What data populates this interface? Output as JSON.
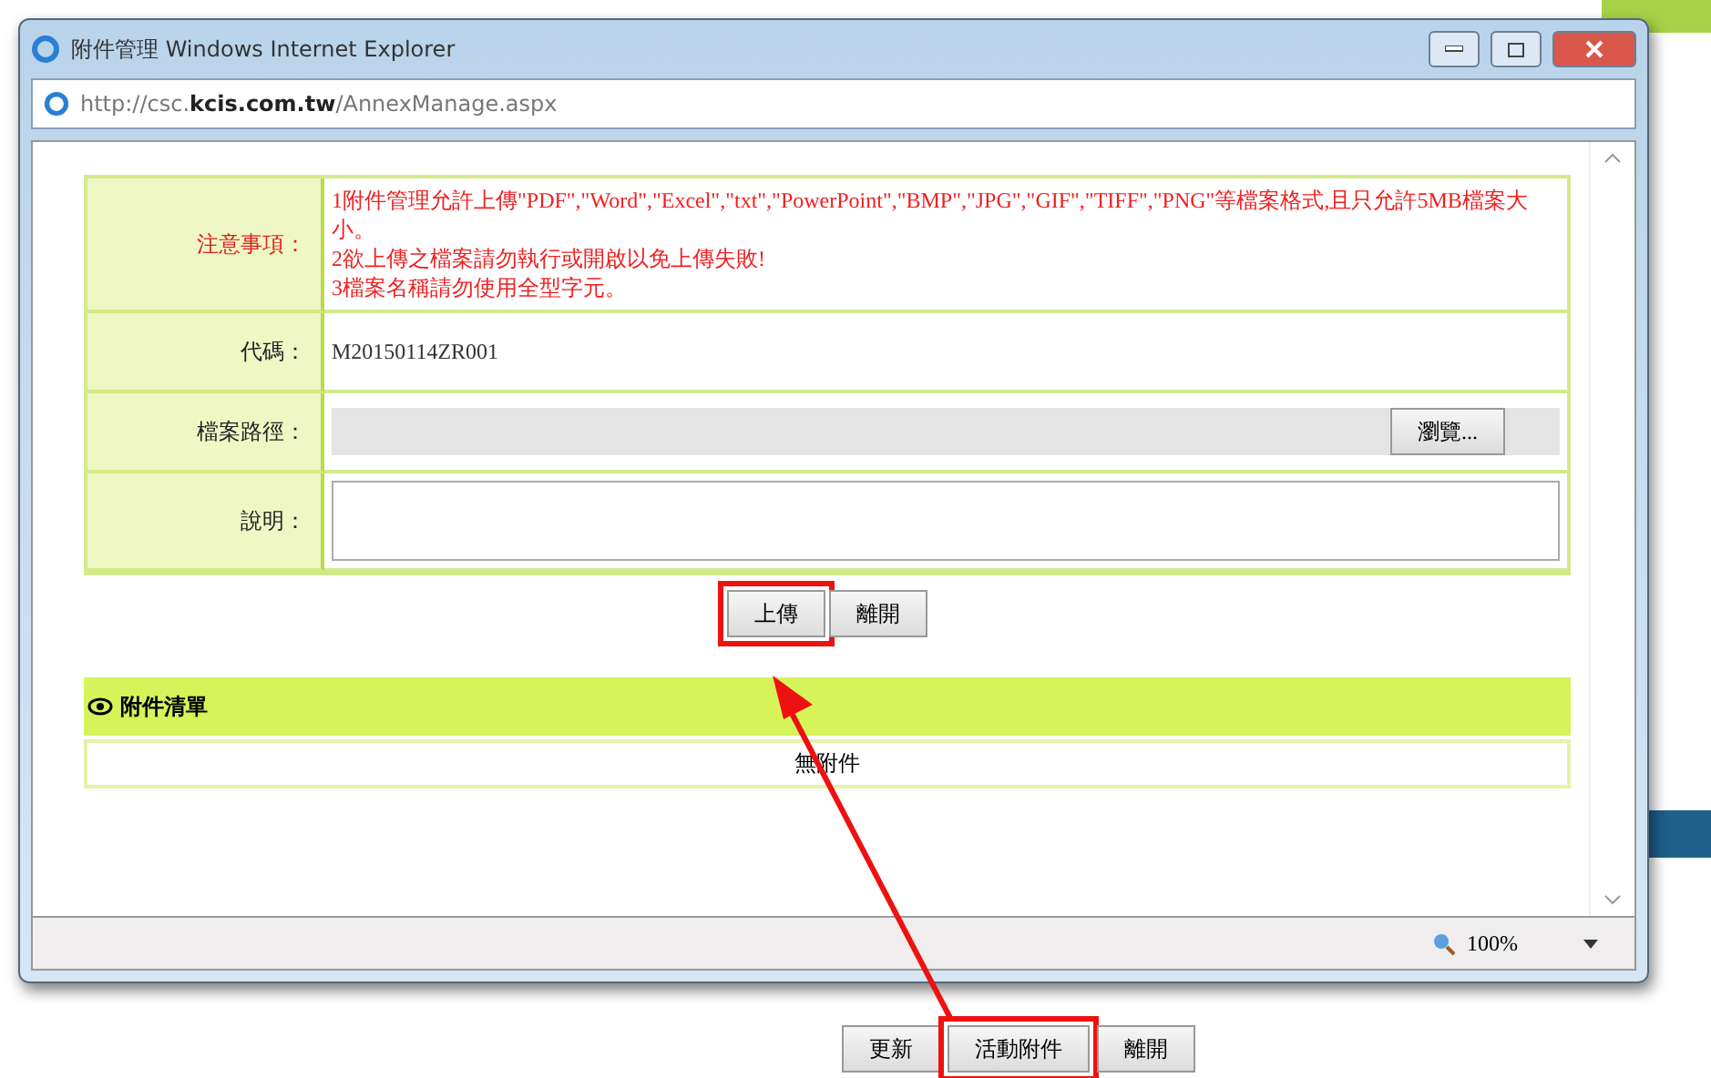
{
  "window": {
    "title": "附件管理 Windows Internet Explorer",
    "address": "http://csc.**kcis.com.tw**/AnnexManage.aspx"
  },
  "form": [
    {
      "kind": "notes",
      "label": "注意事項：",
      "lines": [
        "1附件管理允許上傳\"PDF\",\"Word\",\"Excel\",\"txt\",\"PowerPoint\",\"BMP\",\"JPG\",\"GIF\",\"TIFF\",\"PNG\"等檔案格式,且只允許5MB檔案大小。",
        "2欲上傳之檔案請勿執行或開啟以免上傳失敗!",
        "3檔案名稱請勿使用全型字元。"
      ]
    },
    {
      "kind": "text",
      "label": "代碼：",
      "value": "M20150114ZR001"
    },
    {
      "kind": "file",
      "label": "檔案路徑：",
      "button": "瀏覽..."
    },
    {
      "kind": "textarea",
      "label": "說明："
    }
  ],
  "actions": [
    {
      "label": "上傳",
      "highlighted": true
    },
    {
      "label": "離開",
      "highlighted": false
    }
  ],
  "attachments": {
    "title": "附件清單",
    "empty": "無附件"
  },
  "status_bar": {
    "zoom": "100%"
  },
  "page_buttons": [
    {
      "label": "更新",
      "highlighted": false
    },
    {
      "label": "活動附件",
      "highlighted": true
    },
    {
      "label": "離開",
      "highlighted": false
    }
  ]
}
